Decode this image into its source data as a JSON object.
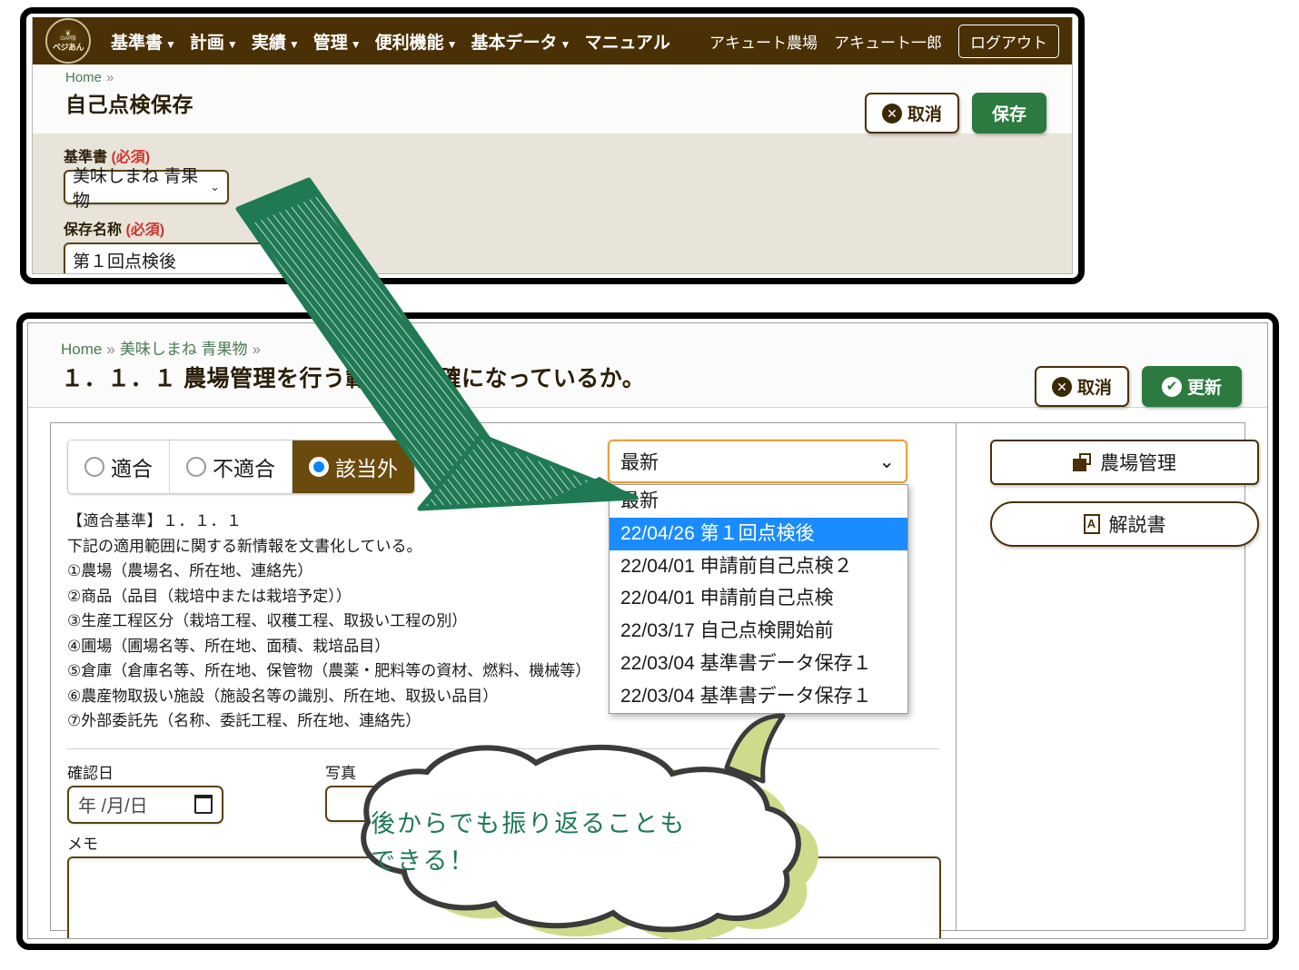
{
  "colors": {
    "nav_bg": "#4a3005",
    "accent_brown": "#6b4a0d",
    "green": "#2c7a3f",
    "arrow_green": "#1f7a54",
    "highlight_blue": "#1a8cff",
    "form_bg": "#e8e4d9",
    "required_red": "#d0342c"
  },
  "top_window": {
    "nav": {
      "logo": {
        "line1": "GAP版",
        "line2": "ベジあん",
        "icon": "leaf-badge-icon"
      },
      "items": [
        {
          "label": "基準書",
          "has_caret": true
        },
        {
          "label": "計画",
          "has_caret": true
        },
        {
          "label": "実績",
          "has_caret": true
        },
        {
          "label": "管理",
          "has_caret": true
        },
        {
          "label": "便利機能",
          "has_caret": true
        },
        {
          "label": "基本データ",
          "has_caret": true
        },
        {
          "label": "マニュアル",
          "has_caret": false
        }
      ],
      "farm_name": "アキュート農場",
      "user_name": "アキュート一郎",
      "logout_label": "ログアウト"
    },
    "breadcrumb": {
      "home": "Home",
      "sep": "»"
    },
    "page_title": "自己点検保存",
    "actions": {
      "cancel_label": "取消",
      "save_label": "保存"
    },
    "form": {
      "standard_label": "基準書",
      "standard_required": "(必須)",
      "standard_value": "美味しまね 青果物",
      "name_label": "保存名称",
      "name_required": "(必須)",
      "name_value": "第１回点検後"
    }
  },
  "bottom_window": {
    "breadcrumb": {
      "home": "Home",
      "sep": "»",
      "mid": "美味しまね 青果物",
      "sep2": "»"
    },
    "page_title": "１．１．１ 農場管理を行う範囲が明確になっているか。",
    "actions": {
      "cancel_label": "取消",
      "update_label": "更新"
    },
    "radio_options": [
      {
        "label": "適合",
        "selected": false
      },
      {
        "label": "不適合",
        "selected": false
      },
      {
        "label": "該当外",
        "selected": true
      }
    ],
    "history_select": {
      "value": "最新",
      "options": [
        {
          "label": "最新",
          "highlight": false
        },
        {
          "label": "22/04/26 第１回点検後",
          "highlight": true
        },
        {
          "label": "22/04/01 申請前自己点検２",
          "highlight": false
        },
        {
          "label": "22/04/01 申請前自己点検",
          "highlight": false
        },
        {
          "label": "22/03/17 自己点検開始前",
          "highlight": false
        },
        {
          "label": "22/03/04 基準書データ保存１",
          "highlight": false
        },
        {
          "label": "22/03/04 基準書データ保存１",
          "highlight": false
        }
      ]
    },
    "criteria": {
      "heading": "【適合基準】１．１．１",
      "lines": [
        "下記の適用範囲に関する新情報を文書化している。",
        "①農場（農場名、所在地、連絡先）",
        "②商品（品目（栽培中または栽培予定））",
        "③生産工程区分（栽培工程、収穫工程、取扱い工程の別）",
        "④圃場（圃場名等、所在地、面積、栽培品目）",
        "⑤倉庫（倉庫名等、所在地、保管物（農薬・肥料等の資材、燃料、機械等）",
        "⑥農産物取扱い施設（施設名等の識別、所在地、取扱い品目）",
        "⑦外部委託先（名称、委託工程、所在地、連絡先）"
      ]
    },
    "confirm_date": {
      "label": "確認日",
      "placeholder": "年 /月/日"
    },
    "photo": {
      "label": "写真",
      "button_label": ""
    },
    "memo": {
      "label": "メモ",
      "value": ""
    },
    "side_buttons": [
      {
        "label": "農場管理",
        "icon": "copy-icon",
        "shape": "rect"
      },
      {
        "label": "解説書",
        "icon": "pdf-icon",
        "shape": "pill"
      }
    ]
  },
  "annotations": {
    "arrow": {
      "icon": "hand-drawn-arrow-icon",
      "color": "#1f7a54"
    },
    "bubble": {
      "text": "後からでも振り返ることも\nできる！",
      "color": "#1f7a54"
    }
  }
}
